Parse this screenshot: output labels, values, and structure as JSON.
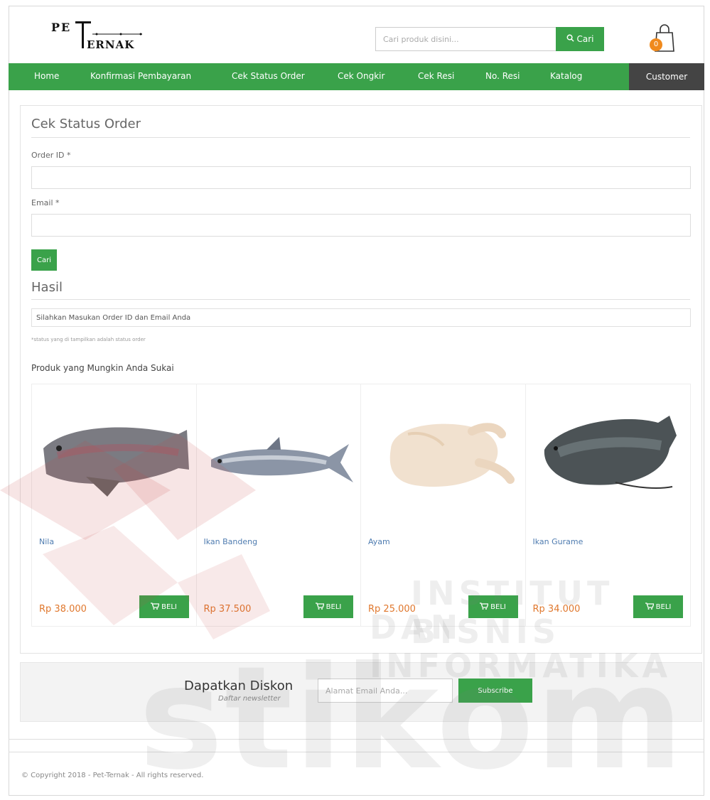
{
  "header": {
    "logo_text_top": "PET",
    "logo_text_bottom": "ERNAK",
    "search_placeholder": "Cari produk disini...",
    "search_button": "Cari",
    "cart_count": "0"
  },
  "nav": {
    "items": [
      "Home",
      "Konfirmasi Pembayaran",
      "Cek Status Order",
      "Cek Ongkir",
      "Cek Resi",
      "No. Resi",
      "Katalog"
    ],
    "customer": "Customer"
  },
  "form": {
    "title": "Cek Status Order",
    "order_id_label": "Order ID *",
    "email_label": "Email *",
    "submit": "Cari"
  },
  "result": {
    "title": "Hasil",
    "message": "Silahkan Masukan Order ID dan Email Anda",
    "note": "*status yang di tampilkan adalah status order"
  },
  "related": {
    "title": "Produk yang Mungkin Anda Sukai",
    "products": [
      {
        "name": "Nila",
        "price": "Rp 38.000",
        "button": "BELI"
      },
      {
        "name": "Ikan Bandeng",
        "price": "Rp 37.500",
        "button": "BELI"
      },
      {
        "name": "Ayam",
        "price": "Rp 25.000",
        "button": "BELI"
      },
      {
        "name": "Ikan Gurame",
        "price": "Rp 34.000",
        "button": "BELI"
      }
    ]
  },
  "newsletter": {
    "title": "Dapatkan Diskon",
    "subtitle": "Daftar newsletter",
    "placeholder": "Alamat Email Anda...",
    "button": "Subscribe"
  },
  "footer": {
    "copyright": "© Copyright 2018 - Pet-Ternak - All rights reserved."
  },
  "watermark": {
    "line1": "INSTITUT BISNIS",
    "line2": "DAN INFORMATIKA",
    "brand": "stikom"
  },
  "colors": {
    "accent": "#3aa24a",
    "dark": "#444444",
    "price": "#e0782e",
    "link": "#4f7cb0",
    "badge": "#f08a1d"
  }
}
